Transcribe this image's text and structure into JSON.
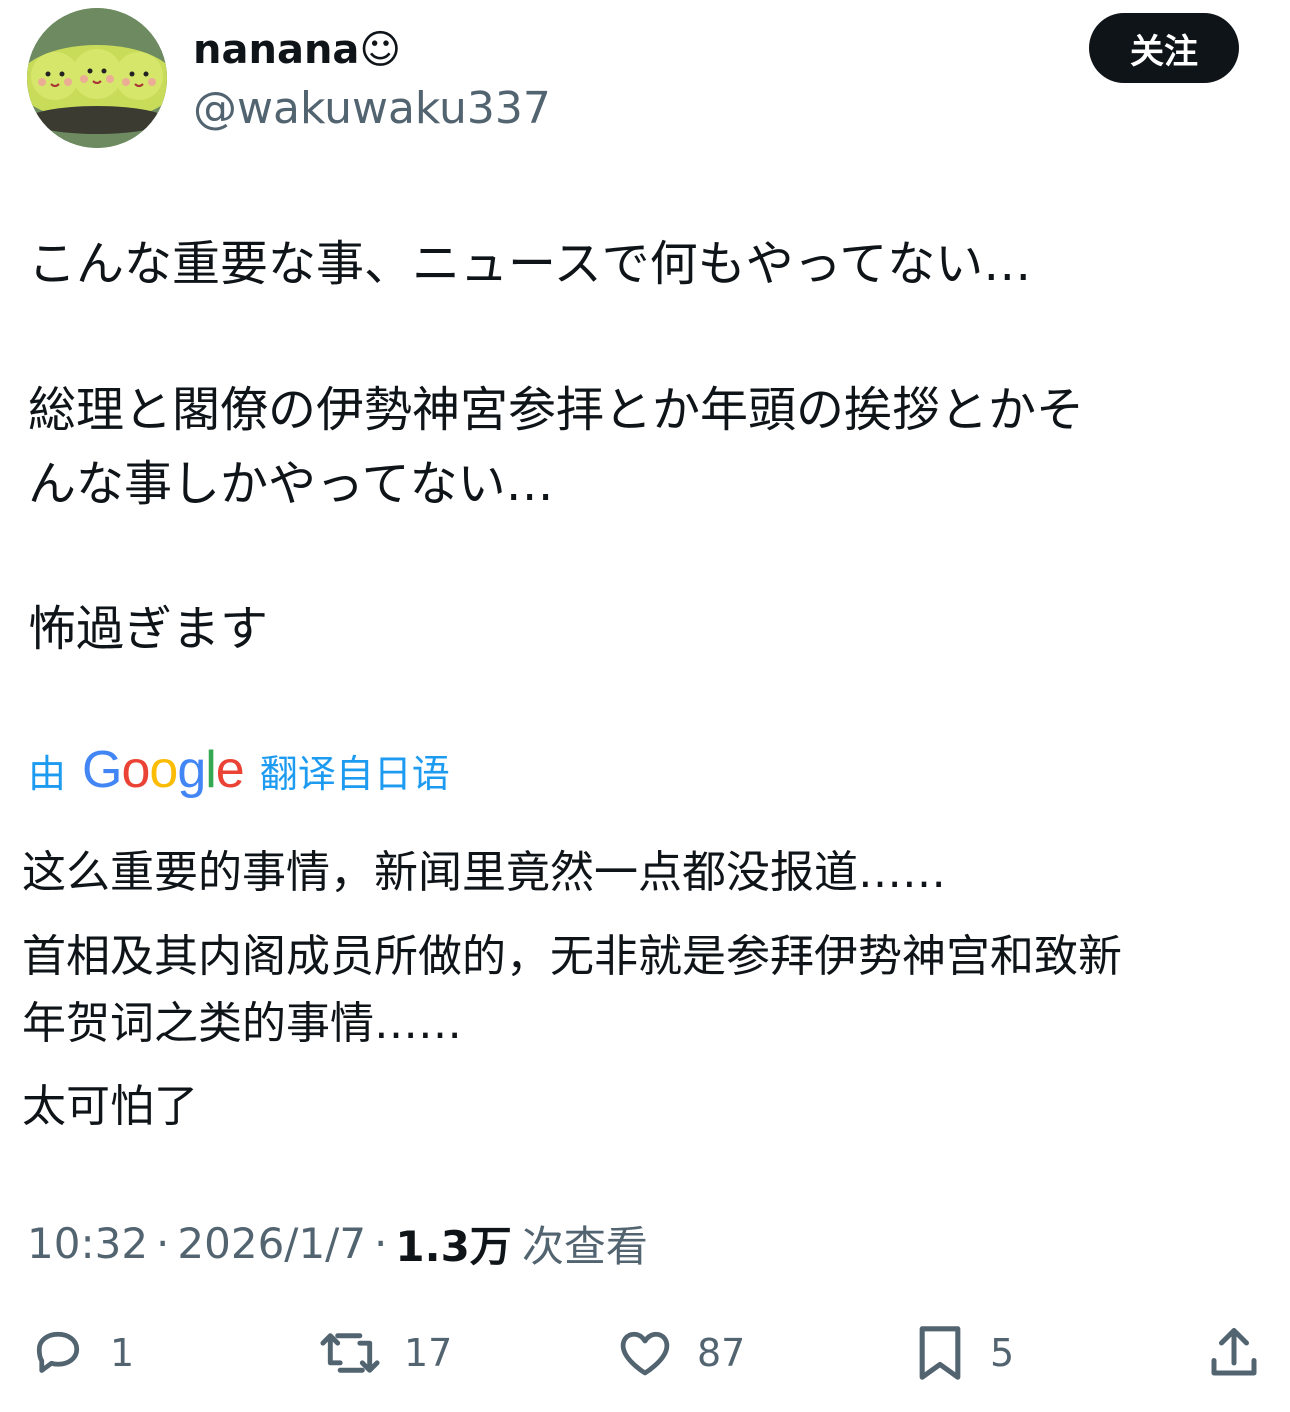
{
  "user": {
    "display_name": "nanana☺",
    "handle": "@wakuwaku337"
  },
  "header": {
    "follow_label": "关注"
  },
  "tweet": {
    "lines": [
      "こんな重要な事、ニュースで何もやってない…",
      "総理と閣僚の伊勢神宮参拝とか年頭の挨拶とかそ",
      "んな事しかやってない…",
      "怖過ぎます"
    ]
  },
  "translation": {
    "by_label": "由",
    "brand": "Google",
    "from_label": "翻译自日语",
    "lines": [
      "这么重要的事情，新闻里竟然一点都没报道……",
      "首相及其内阁成员所做的，无非就是参拜伊势神宫和致新",
      "年贺词之类的事情……",
      "太可怕了"
    ]
  },
  "meta": {
    "time": "10:32",
    "date": "2026/1/7",
    "views_count": "1.3万",
    "views_label": "次查看"
  },
  "actions": {
    "replies": "1",
    "retweets": "17",
    "likes": "87",
    "bookmarks": "5"
  },
  "colors": {
    "text": "#0f1419",
    "secondary": "#536471",
    "accent": "#1d9bf0"
  }
}
